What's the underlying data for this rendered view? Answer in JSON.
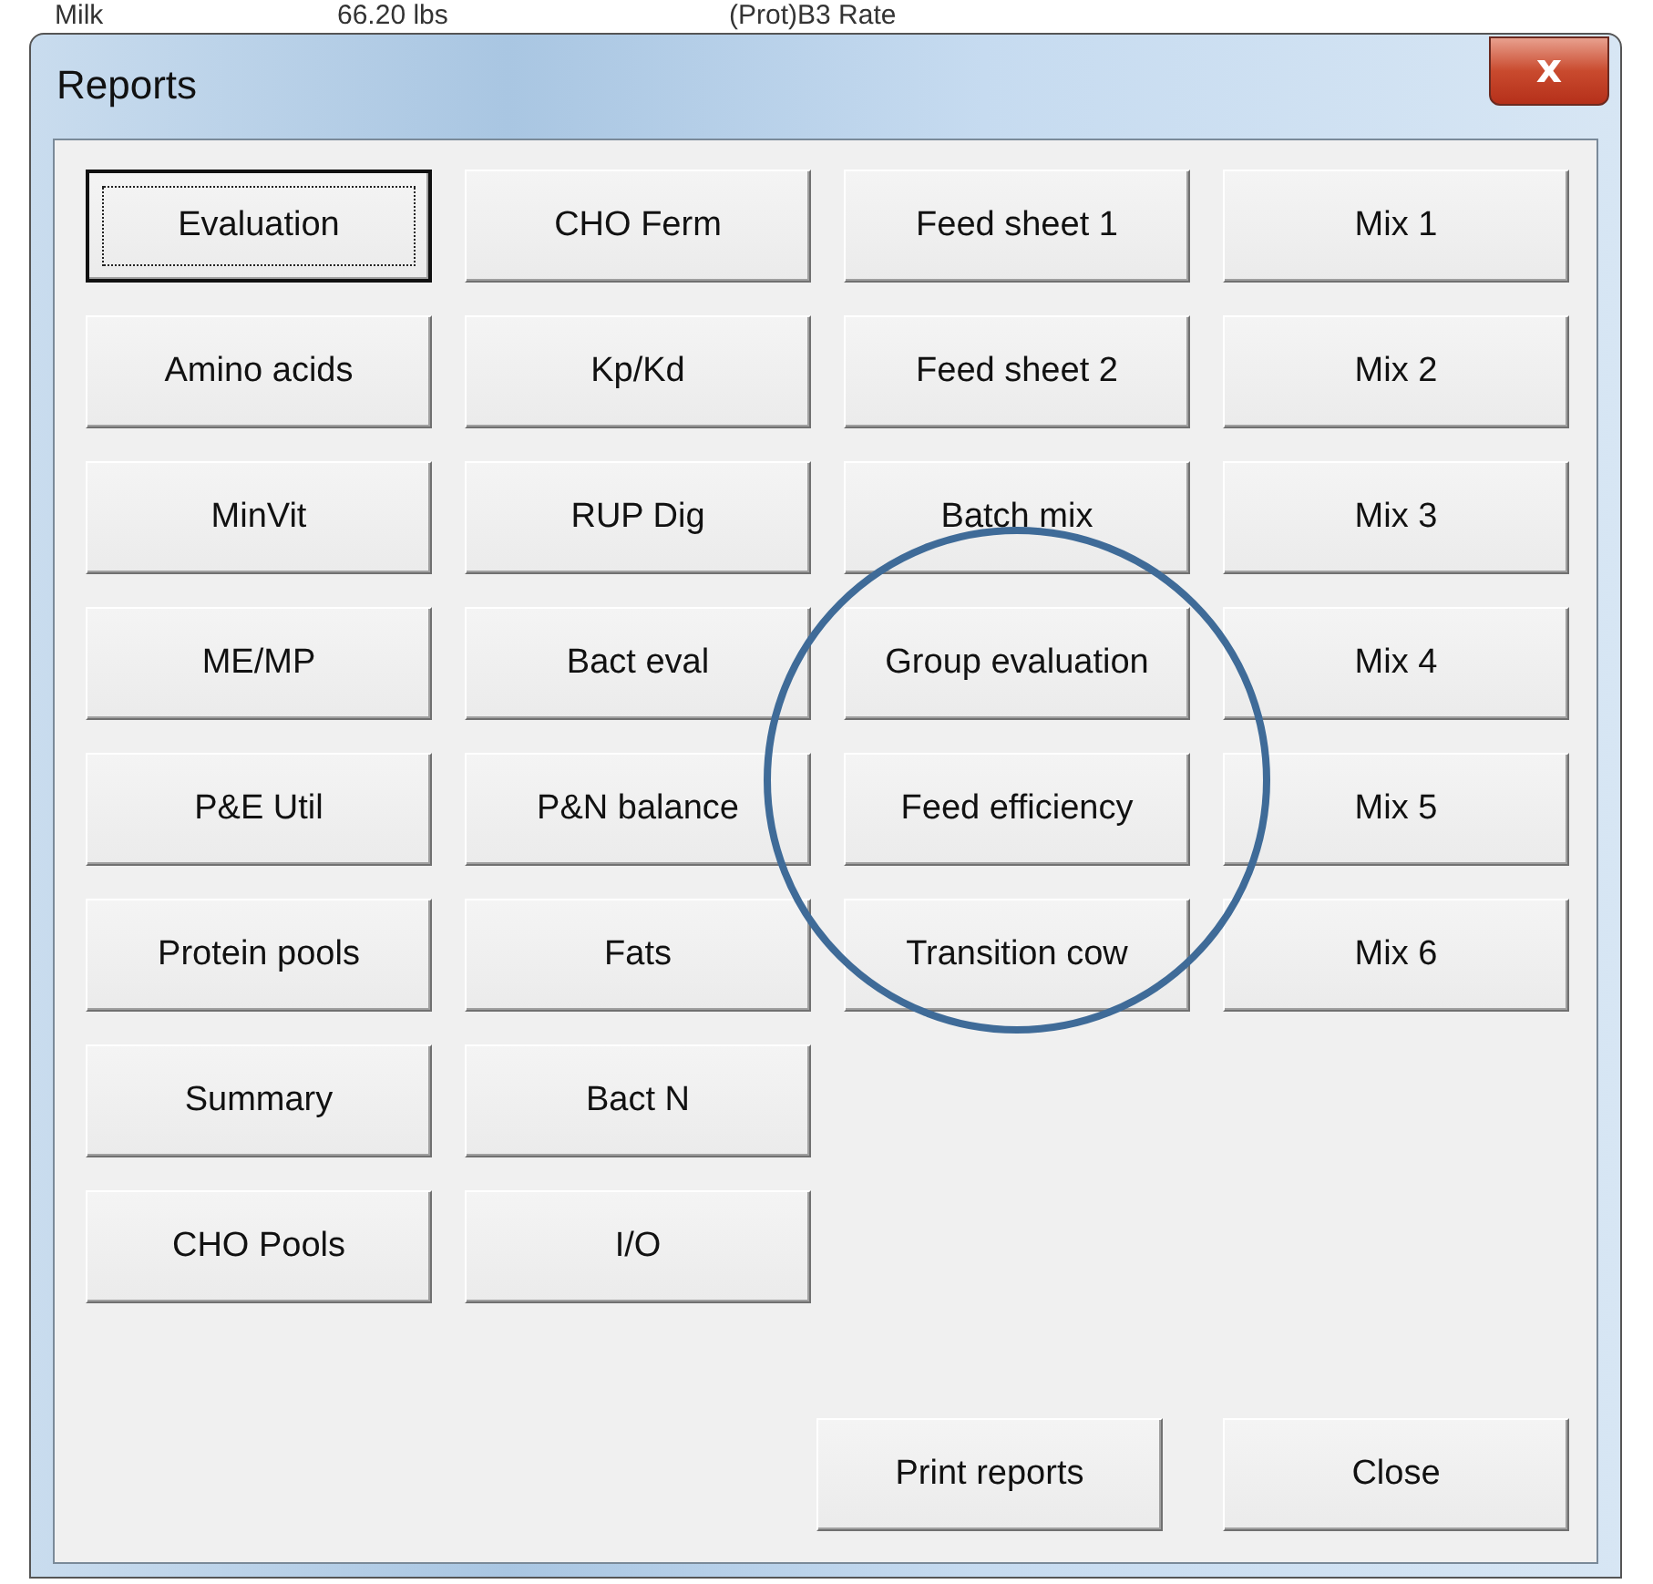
{
  "background_row": [
    "Milk",
    "66.20 lbs",
    "(Prot)B3 Rate"
  ],
  "window": {
    "title": "Reports",
    "close_glyph": "x"
  },
  "button_columns": [
    [
      {
        "label": "Evaluation",
        "focused": true
      },
      {
        "label": "Amino acids",
        "focused": false
      },
      {
        "label": "MinVit",
        "focused": false
      },
      {
        "label": "ME/MP",
        "focused": false
      },
      {
        "label": "P&E Util",
        "focused": false
      },
      {
        "label": "Protein pools",
        "focused": false
      },
      {
        "label": "Summary",
        "focused": false
      },
      {
        "label": "CHO Pools",
        "focused": false
      }
    ],
    [
      {
        "label": "CHO Ferm",
        "focused": false
      },
      {
        "label": "Kp/Kd",
        "focused": false
      },
      {
        "label": "RUP Dig",
        "focused": false
      },
      {
        "label": "Bact eval",
        "focused": false
      },
      {
        "label": "P&N balance",
        "focused": false
      },
      {
        "label": "Fats",
        "focused": false
      },
      {
        "label": "Bact N",
        "focused": false
      },
      {
        "label": "I/O",
        "focused": false
      }
    ],
    [
      {
        "label": "Feed sheet 1",
        "focused": false
      },
      {
        "label": "Feed sheet 2",
        "focused": false
      },
      {
        "label": "Batch mix",
        "focused": false
      },
      {
        "label": "Group evaluation",
        "focused": false
      },
      {
        "label": "Feed efficiency",
        "focused": false
      },
      {
        "label": "Transition cow",
        "focused": false
      }
    ],
    [
      {
        "label": "Mix 1",
        "focused": false
      },
      {
        "label": "Mix 2",
        "focused": false
      },
      {
        "label": "Mix 3",
        "focused": false
      },
      {
        "label": "Mix 4",
        "focused": false
      },
      {
        "label": "Mix 5",
        "focused": false
      },
      {
        "label": "Mix 6",
        "focused": false
      }
    ]
  ],
  "footer_buttons": [
    {
      "label": "Print reports",
      "focused": false
    },
    {
      "label": "Close",
      "focused": false
    }
  ]
}
